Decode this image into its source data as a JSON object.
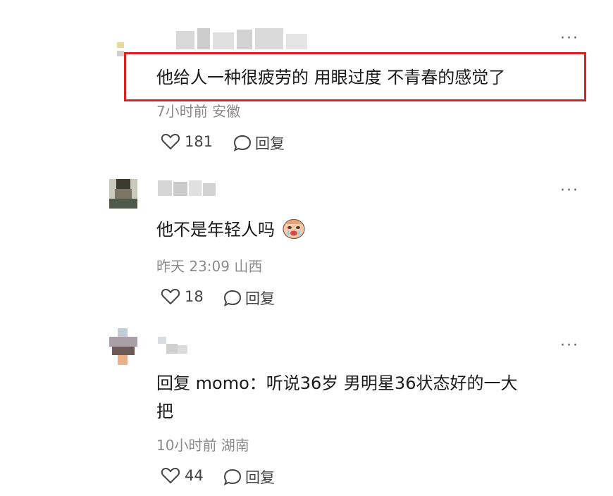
{
  "comments": [
    {
      "text": "他给人一种很疲劳的 用眼过度 不青春的感觉了",
      "meta": "7小时前 安徽",
      "likes": "181",
      "reply_label": "回复",
      "more_label": "···"
    },
    {
      "text": "他不是年轻人吗",
      "emoji": "crying-face-emoji",
      "meta": "昨天 23:09 山西",
      "likes": "18",
      "reply_label": "回复",
      "more_label": "···"
    },
    {
      "text_line1": "回复 momo：听说36岁 男明星36状态好的一大",
      "text_line2": "把",
      "meta": "10小时前 湖南",
      "likes": "44",
      "reply_label": "回复",
      "more_label": "···"
    }
  ],
  "icons": {
    "like": "heart-outline-icon",
    "reply": "speech-bubble-icon",
    "more": "ellipsis-icon"
  },
  "colors": {
    "highlight": "#e02020",
    "meta_text": "#8a8a8a"
  }
}
